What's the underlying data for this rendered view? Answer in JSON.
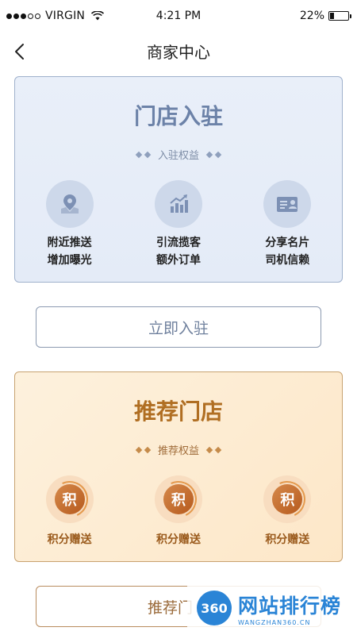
{
  "status_bar": {
    "carrier": "VIRGIN",
    "time": "4:21 PM",
    "battery": "22%",
    "battery_level": 0.22
  },
  "nav": {
    "title": "商家中心"
  },
  "join_card": {
    "title": "门店入驻",
    "subtitle": "入驻权益",
    "benefits": [
      {
        "line1": "附近推送",
        "line2": "增加曝光",
        "icon": "location-icon"
      },
      {
        "line1": "引流揽客",
        "line2": "额外订单",
        "icon": "growth-chart-icon"
      },
      {
        "line1": "分享名片",
        "line2": "司机信赖",
        "icon": "business-card-icon"
      }
    ],
    "button": "立即入驻"
  },
  "recommend_card": {
    "title": "推荐门店",
    "subtitle": "推荐权益",
    "coin_glyph": "积",
    "benefits": [
      {
        "label": "积分赠送"
      },
      {
        "label": "积分赠送"
      },
      {
        "label": "积分赠送"
      }
    ],
    "button": "推荐门"
  },
  "watermark": {
    "logo": "360",
    "text": "网站排行榜",
    "sub": "WANGZHAN360.CN"
  },
  "colors": {
    "join_accent": "#6c82a8",
    "recommend_accent": "#b06e22",
    "watermark_blue": "#2a84d6"
  }
}
